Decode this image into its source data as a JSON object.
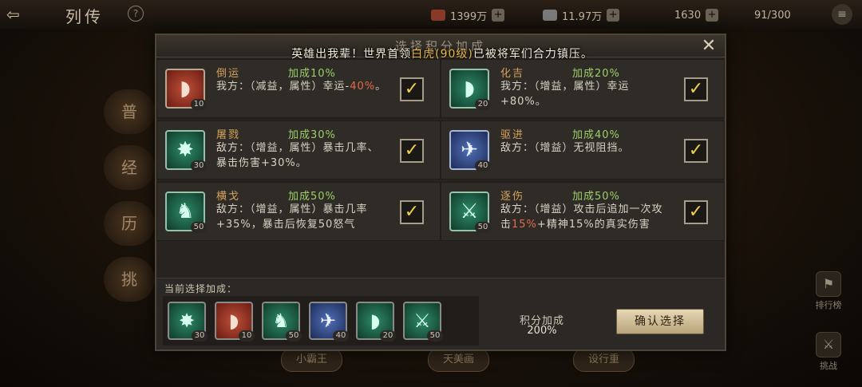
{
  "top": {
    "title": "列传",
    "help_label": "?",
    "res1": "1399万",
    "res2": "11.97万",
    "res3": "1630",
    "res4": "91/300",
    "back_glyph": "⇦",
    "menu_glyph": "≡"
  },
  "side_left": [
    "普",
    "经",
    "历",
    "挑"
  ],
  "side_right": [
    {
      "label": "排行榜",
      "glyph": "⚑"
    },
    {
      "label": "挑战",
      "glyph": "⚔"
    }
  ],
  "bottom_tabs": [
    "小霸王",
    "天美画",
    "设行重"
  ],
  "dialog": {
    "title": "选择积分加成",
    "notice_prefix": "英雄出我辈！世界首领",
    "notice_boss": "白虎(90级)",
    "notice_suffix": "已被将军们合力镇压。",
    "close_glyph": "✕",
    "check_glyph": "✓",
    "cards": [
      {
        "name": "倒运",
        "bonus": "加成10%",
        "desc_a": "我方：（减益，属性）幸运-",
        "desc_hl": "40%",
        "desc_b": "。",
        "level": "10",
        "glyph": "◗",
        "color": "red"
      },
      {
        "name": "化吉",
        "bonus": "加成20%",
        "desc_a": "我方：（增益，属性）幸运",
        "desc_hl": "",
        "desc_b": "+80%。",
        "level": "20",
        "glyph": "◗",
        "color": "green"
      },
      {
        "name": "屠戮",
        "bonus": "加成30%",
        "desc_a": "敌方：（增益，属性）暴击几率、暴击伤害+30%。",
        "desc_hl": "",
        "desc_b": "",
        "level": "30",
        "glyph": "✸",
        "color": "green"
      },
      {
        "name": "驱进",
        "bonus": "加成40%",
        "desc_a": "敌方：（增益）无视阻挡。",
        "desc_hl": "",
        "desc_b": "",
        "level": "40",
        "glyph": "✈",
        "color": "blue"
      },
      {
        "name": "横戈",
        "bonus": "加成50%",
        "desc_a": "敌方：（增益，属性）暴击几率+35%，暴击后恢复50怒气",
        "desc_hl": "",
        "desc_b": "",
        "level": "50",
        "glyph": "♞",
        "color": "green"
      },
      {
        "name": "逐伤",
        "bonus": "加成50%",
        "desc_a": "敌方：（增益）攻击后追加一次攻击",
        "desc_hl": "15%",
        "desc_b": "+精神15%的真实伤害",
        "level": "50",
        "glyph": "⚔",
        "color": "green"
      }
    ],
    "current_label": "当前选择加成：",
    "selected": [
      {
        "glyph": "✸",
        "level": "30",
        "color": "green"
      },
      {
        "glyph": "◗",
        "level": "10",
        "color": "red"
      },
      {
        "glyph": "♞",
        "level": "50",
        "color": "green"
      },
      {
        "glyph": "✈",
        "level": "40",
        "color": "blue"
      },
      {
        "glyph": "◗",
        "level": "20",
        "color": "green"
      },
      {
        "glyph": "⚔",
        "level": "50",
        "color": "green"
      }
    ],
    "score_label": "积分加成",
    "score_value": "200%",
    "confirm_label": "确认选择"
  }
}
